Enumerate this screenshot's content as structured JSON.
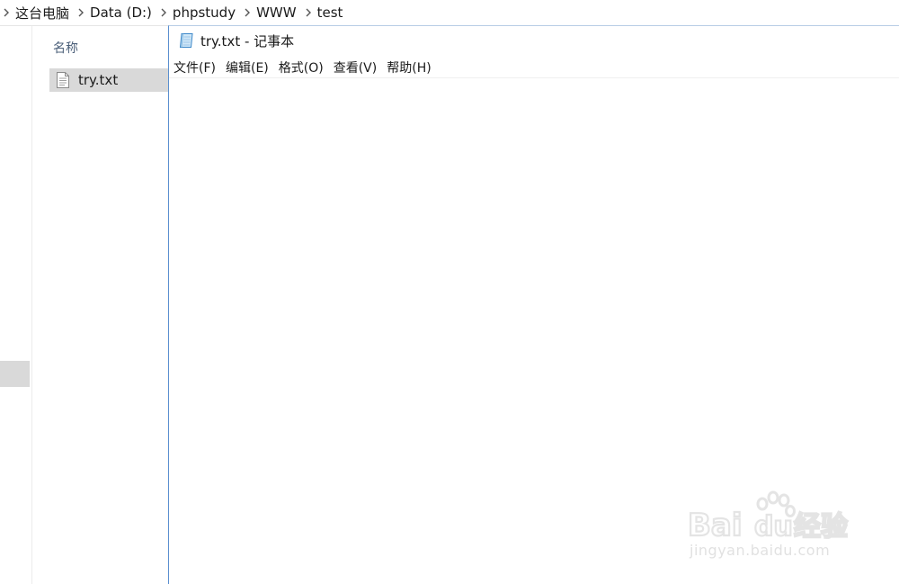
{
  "explorer": {
    "breadcrumb": [
      "这台电脑",
      "Data (D:)",
      "phpstudy",
      "WWW",
      "test"
    ],
    "column_header": "名称",
    "files": [
      {
        "name": "try.txt",
        "icon": "text-file-icon",
        "selected": true
      }
    ]
  },
  "notepad": {
    "title": "try.txt - 记事本",
    "icon": "notepad-icon",
    "menu": [
      "文件(F)",
      "编辑(E)",
      "格式(O)",
      "查看(V)",
      "帮助(H)"
    ],
    "content": ""
  },
  "watermark": {
    "logo_text": "Baidu经验",
    "url": "jingyan.baidu.com"
  },
  "colors": {
    "selection": "#d9d9d9",
    "window_border": "#5a8fcf",
    "header_text": "#4c607a"
  }
}
